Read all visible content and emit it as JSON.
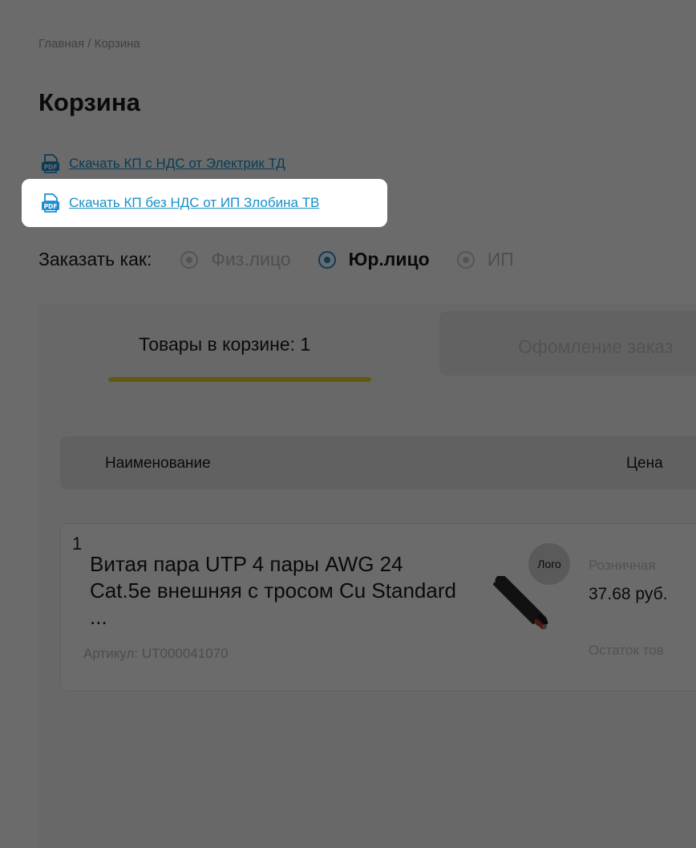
{
  "breadcrumb": {
    "text": "Главная / Корзина"
  },
  "page_title": "Корзина",
  "downloads": [
    {
      "label": "Скачать КП с НДС от Электрик ТД",
      "icon": "pdf-icon"
    },
    {
      "label": "Скачать КП без НДС от ИП Злобина ТВ",
      "icon": "pdf-icon"
    }
  ],
  "order_as": {
    "label": "Заказать как:",
    "options": [
      {
        "label": "Физ.лицо",
        "selected": false
      },
      {
        "label": "Юр.лицо",
        "selected": true
      },
      {
        "label": "ИП",
        "selected": false
      }
    ]
  },
  "tabs": [
    {
      "label": "Товары в корзине: 1",
      "active": true
    },
    {
      "label": "Офомление заказ",
      "active": false
    }
  ],
  "table": {
    "headers": [
      "Наименование",
      "Цена"
    ]
  },
  "items": [
    {
      "num": "1",
      "name": "Витая пара UTP 4 пары AWG 24 Cat.5e внешняя с тросом Cu Standard ...",
      "sku": "Артикул: UT000041070",
      "logo": "Лого",
      "price_type": "Розничная",
      "price": "37.68 руб.",
      "stock": "Остаток тов"
    }
  ],
  "colors": {
    "accent": "#1b8fd0",
    "link": "#1590c8",
    "tab_underline": "#e8d31f",
    "overlay": "rgba(0,0,0,0.58)"
  }
}
